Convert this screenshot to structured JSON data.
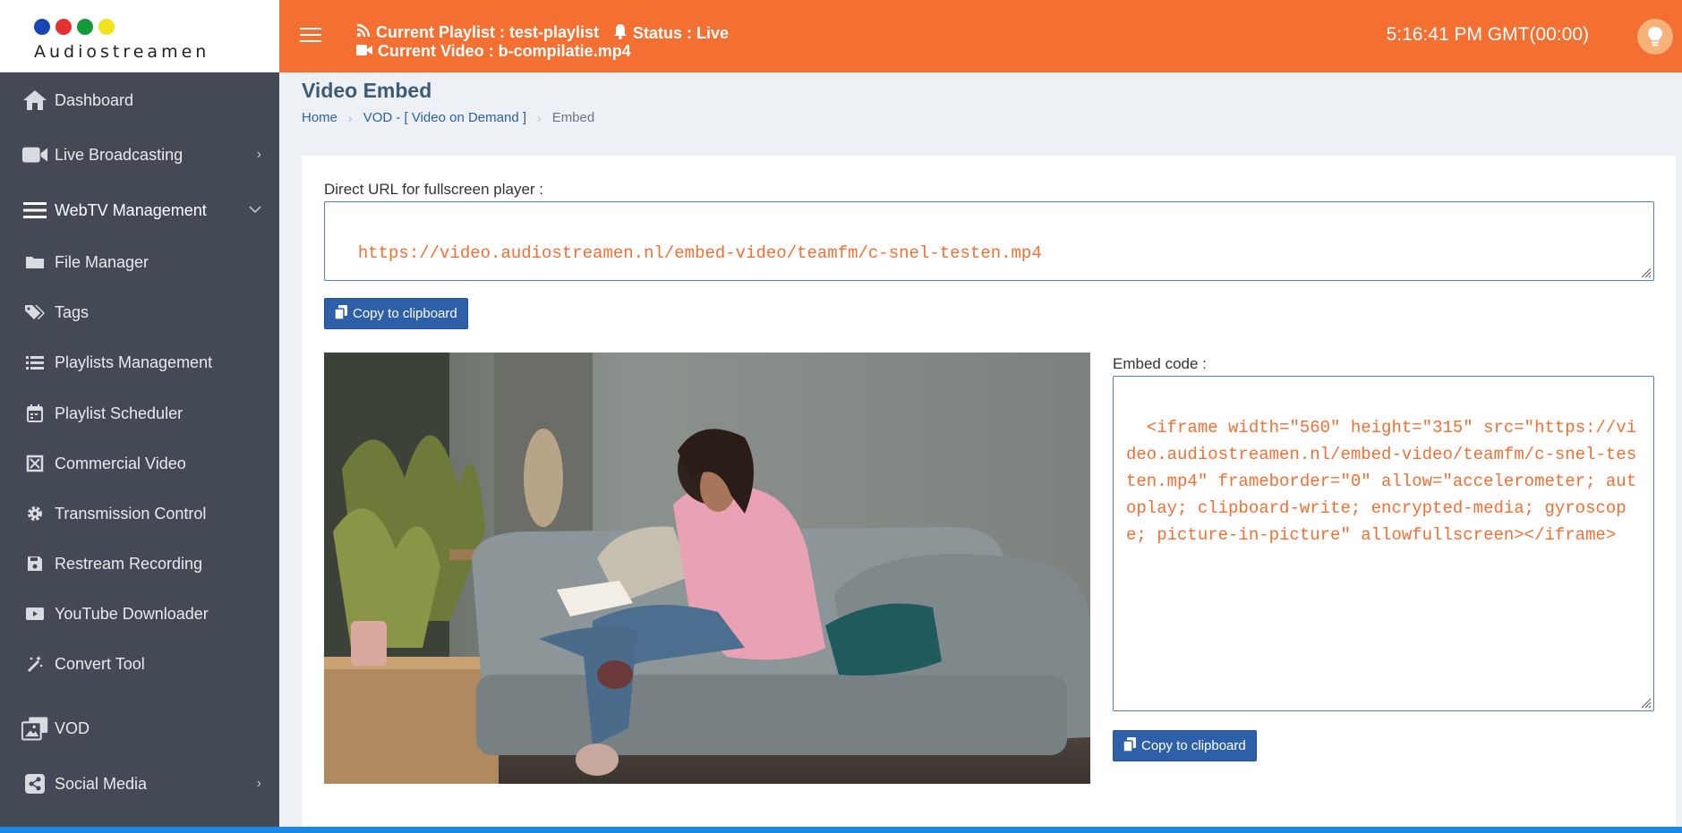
{
  "logo": {
    "text": "Audiostreamen",
    "dot_colors": [
      "#1846b4",
      "#e53131",
      "#159a3a",
      "#f2e41c"
    ]
  },
  "header": {
    "playlist": "Current Playlist : test-playlist",
    "status": "Status : Live",
    "video": "Current Video : b-compilatie.mp4",
    "clock": "5:16:41 PM GMT(00:00)"
  },
  "sidebar": {
    "items": [
      {
        "label": "Dashboard",
        "icon": "home-icon"
      },
      {
        "label": "Live Broadcasting",
        "icon": "video-camera-icon",
        "chevron": "right"
      },
      {
        "label": "WebTV Management",
        "icon": "menu-icon",
        "chevron": "down"
      },
      {
        "label": "File Manager",
        "icon": "folder-icon"
      },
      {
        "label": "Tags",
        "icon": "tags-icon"
      },
      {
        "label": "Playlists Management",
        "icon": "list-icon"
      },
      {
        "label": "Playlist Scheduler",
        "icon": "calendar-icon"
      },
      {
        "label": "Commercial Video",
        "icon": "crop-icon"
      },
      {
        "label": "Transmission Control",
        "icon": "gear-icon"
      },
      {
        "label": "Restream Recording",
        "icon": "save-icon"
      },
      {
        "label": "YouTube Downloader",
        "icon": "youtube-icon"
      },
      {
        "label": "Convert Tool",
        "icon": "magic-wand-icon"
      },
      {
        "label": "VOD",
        "icon": "photo-film-icon"
      },
      {
        "label": "Social Media",
        "icon": "share-icon",
        "chevron": "right"
      }
    ]
  },
  "page": {
    "title": "Video Embed",
    "breadcrumb": [
      "Home",
      "VOD - [ Video on Demand ]",
      "Embed"
    ]
  },
  "embed": {
    "direct_label": "Direct URL for fullscreen player :",
    "direct_url": "https://video.audiostreamen.nl/embed-video/teamfm/c-snel-testen.mp4",
    "copy_label": "Copy to clipboard",
    "code_label": "Embed code :",
    "embed_code": "<iframe width=\"560\" height=\"315\" src=\"https://video.audiostreamen.nl/embed-video/teamfm/c-snel-testen.mp4\" frameborder=\"0\" allow=\"accelerometer; autoplay; clipboard-write; encrypted-media; gyroscope; picture-in-picture\" allowfullscreen></iframe>"
  },
  "colors": {
    "accent": "#f36f32",
    "sidebar": "#434a56",
    "primary_button": "#2d60a9"
  }
}
